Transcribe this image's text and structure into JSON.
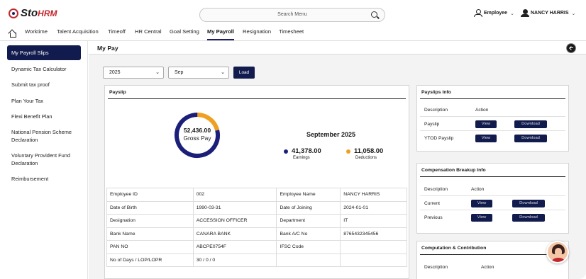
{
  "brand": {
    "name": "Sto",
    "suffix": "HRM"
  },
  "search": {
    "placeholder": "Search Menu"
  },
  "header": {
    "role": "Employee",
    "user": "NANCY HARRIS"
  },
  "nav": [
    "Worktime",
    "Talent Acquisition",
    "Timeoff",
    "HR Central",
    "Goal Setting",
    "My Payroll",
    "Resignation",
    "Timesheet"
  ],
  "nav_active": "My Payroll",
  "sidebar": [
    "My Payroll Slips",
    "Dynamic Tax Calculator",
    "Submit tax proof",
    "Plan Your Tax",
    "Flexi Benefit Plan",
    "National Pension Scheme Declaration",
    "Voluntary Provident Fund Declaration",
    "Reimbursement"
  ],
  "page": {
    "title": "My Pay"
  },
  "filters": {
    "year": "2025",
    "month": "Sep",
    "load_label": "Load"
  },
  "payslip": {
    "title": "Payslip",
    "gross_value": "52,436.00",
    "gross_label": "Gross Pay",
    "period": "September 2025",
    "earnings_value": "41,378.00",
    "earnings_label": "Earnings",
    "deductions_value": "11,058.00",
    "deductions_label": "Deductions",
    "earnings_fraction": 0.789,
    "colors": {
      "earnings": "#1c1f7a",
      "deductions": "#f0a020"
    }
  },
  "employee": [
    [
      "Employee ID",
      "002",
      "Employee Name",
      "NANCY HARRIS"
    ],
    [
      "Date of Birth",
      "1990-03-31",
      "Date of Joining",
      "2024-01-01"
    ],
    [
      "Designation",
      "ACCESSION OFFICER",
      "Department",
      "IT"
    ],
    [
      "Bank Name",
      "CANARA BANK",
      "Bank A/C No",
      "8765432345456"
    ],
    [
      "PAN NO",
      "ABCPE0754F",
      "IFSC Code",
      ""
    ],
    [
      "No of Days / LOP/LOPR",
      "30 / 0 / 0",
      "",
      ""
    ]
  ],
  "payslips_info": {
    "title": "Payslips Info",
    "col_desc": "Description",
    "col_action": "Action",
    "rows": [
      "Payslip",
      "YTOD Payslip"
    ]
  },
  "breakup_info": {
    "title": "Compensation Breakup Info",
    "col_desc": "Description",
    "col_action": "Action",
    "rows": [
      "Current",
      "Previous"
    ]
  },
  "computation": {
    "title": "Computation & Contribution",
    "col_desc": "Description",
    "col_action": "Action"
  },
  "buttons": {
    "view": "View",
    "download": "Download"
  }
}
